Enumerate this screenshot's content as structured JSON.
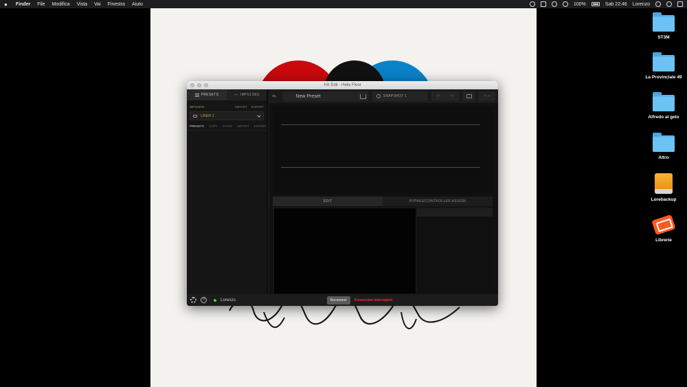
{
  "menubar": {
    "app": "Finder",
    "items": [
      "File",
      "Modifica",
      "Vista",
      "Vai",
      "Finestra",
      "Aiuto"
    ],
    "battery": "100%",
    "clock": "Sab 22:46",
    "user": "Lorenzo"
  },
  "desktop": {
    "icons": [
      {
        "label": "ST3M",
        "icon": "folder-icon"
      },
      {
        "label": "La Provinciale 49",
        "icon": "folder-icon"
      },
      {
        "label": "Alfredo al gelo",
        "icon": "folder-icon"
      },
      {
        "label": "Altro",
        "icon": "folder-icon"
      },
      {
        "label": "Lorebackup",
        "icon": "external-drive-icon"
      },
      {
        "label": "Librerie",
        "icon": "lacie-drive-icon"
      }
    ]
  },
  "hx": {
    "title": "HX Edit - Helix Floor",
    "tabs": {
      "presets": "PRESETS",
      "impulses": "IMPULSES"
    },
    "setlists": {
      "label": "SETLISTS",
      "import": "IMPORT",
      "export": "EXPORT",
      "selected": "USER 1"
    },
    "presets_bar": {
      "label": "PRESETS",
      "actions": [
        "COPY",
        "PASTE",
        "IMPORT",
        "EXPORT"
      ]
    },
    "toolbar": {
      "preset_name": "New Preset",
      "snapshot": "SNAPSHOT 1",
      "tempo": "-- --"
    },
    "edit_tabs": {
      "edit": "EDIT",
      "bypass": "BYPASS/CONTROLLER ASSIGN"
    },
    "status": {
      "user": "Lorenzo",
      "reconnect": "Reconnect",
      "connection": "Connection interrupted",
      "help": "?"
    }
  },
  "colors": {
    "red": "#c9080b",
    "blue": "#0a82c8",
    "status_error": "#ff2b2b",
    "status_ok": "#4ad04a"
  }
}
